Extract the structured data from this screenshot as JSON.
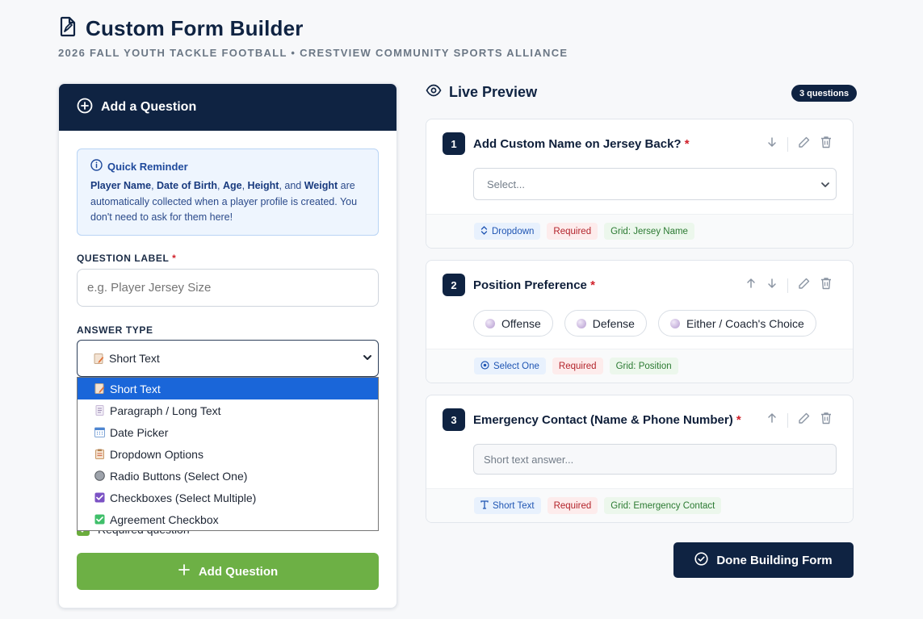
{
  "header": {
    "title": "Custom Form Builder",
    "subtitle": "2026 FALL YOUTH TACKLE FOOTBALL • CRESTVIEW COMMUNITY SPORTS ALLIANCE",
    "icon": "form-file-icon"
  },
  "add_panel": {
    "title": "Add a Question",
    "reminder": {
      "title": "Quick Reminder",
      "f1": "Player Name",
      "s1": ", ",
      "f2": "Date of Birth",
      "s2": ", ",
      "f3": "Age",
      "s3": ", ",
      "f4": "Height",
      "s4": ", and ",
      "f5": "Weight",
      "s5": " are automatically collected when a player profile is created. You don't need to ask for them here!"
    },
    "question_label": {
      "label": "QUESTION LABEL",
      "required_mark": "*",
      "placeholder": "e.g. Player Jersey Size",
      "value": ""
    },
    "answer_type": {
      "label": "ANSWER TYPE",
      "selected": "Short Text",
      "options": [
        {
          "label": "Short Text",
          "icon": "memo-icon"
        },
        {
          "label": "Paragraph / Long Text",
          "icon": "page-icon"
        },
        {
          "label": "Date Picker",
          "icon": "calendar-icon"
        },
        {
          "label": "Dropdown Options",
          "icon": "clipboard-icon"
        },
        {
          "label": "Radio Buttons (Select One)",
          "icon": "radio-icon"
        },
        {
          "label": "Checkboxes (Select Multiple)",
          "icon": "checkbox-icon"
        },
        {
          "label": "Agreement Checkbox",
          "icon": "check-mark-icon"
        }
      ]
    },
    "required_checkbox": {
      "label": "Required question",
      "checked": true
    },
    "add_button": "Add Question"
  },
  "preview": {
    "title": "Live Preview",
    "count_badge": "3 questions",
    "questions": [
      {
        "number": "1",
        "label": "Add Custom Name on Jersey Back?",
        "required_mark": "*",
        "input_placeholder": "Select...",
        "tags": {
          "type": "Dropdown",
          "required": "Required",
          "grid": "Grid: Jersey Name"
        }
      },
      {
        "number": "2",
        "label": "Position Preference",
        "required_mark": "*",
        "options": [
          "Offense",
          "Defense",
          "Either / Coach's Choice"
        ],
        "tags": {
          "type": "Select One",
          "required": "Required",
          "grid": "Grid: Position"
        }
      },
      {
        "number": "3",
        "label": "Emergency Contact (Name & Phone Number)",
        "required_mark": "*",
        "input_placeholder": "Short text answer...",
        "tags": {
          "type": "Short Text",
          "required": "Required",
          "grid": "Grid: Emergency Contact"
        }
      }
    ]
  },
  "done_button": "Done Building Form",
  "colors": {
    "navy": "#0f2342",
    "green": "#6db045",
    "select_blue": "#1a66d9",
    "required_red": "#d0202a"
  }
}
